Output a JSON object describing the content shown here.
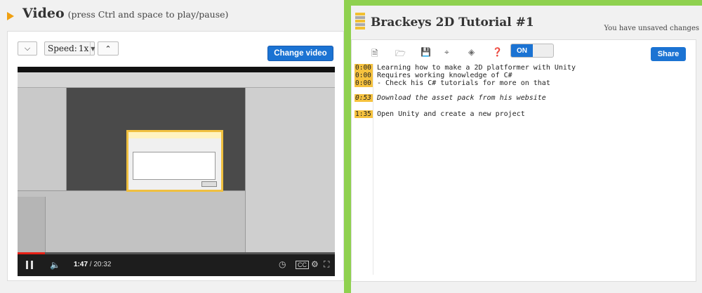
{
  "video": {
    "title": "Video",
    "hint": "(press Ctrl and space to play/pause)",
    "speed_label": "Speed:",
    "speed_value": "1x",
    "change_video_label": "Change video",
    "current_time": "1:47",
    "total_time": "/ 20:32",
    "progress": 0.087
  },
  "notes": {
    "title": "Brackeys 2D Tutorial #1",
    "unsaved": "You have unsaved changes",
    "toggle_label": "ON",
    "share_label": "Share",
    "entries": [
      {
        "time": "0:00",
        "text": "Learning how to make a 2D platformer with Unity"
      },
      {
        "time": "0:00",
        "text": "Requires working knowledge of C#"
      },
      {
        "time": "0:00",
        "text": "- Check his C# tutorials for more on that"
      },
      {
        "time": "0:53",
        "text": "Download the asset pack from his website"
      },
      {
        "time": "1:35",
        "text": "Open Unity and create a new project"
      }
    ]
  },
  "colors": {
    "accent": "#1b73d3",
    "timestamp": "#f6c23e",
    "background": "#8fd14f"
  }
}
